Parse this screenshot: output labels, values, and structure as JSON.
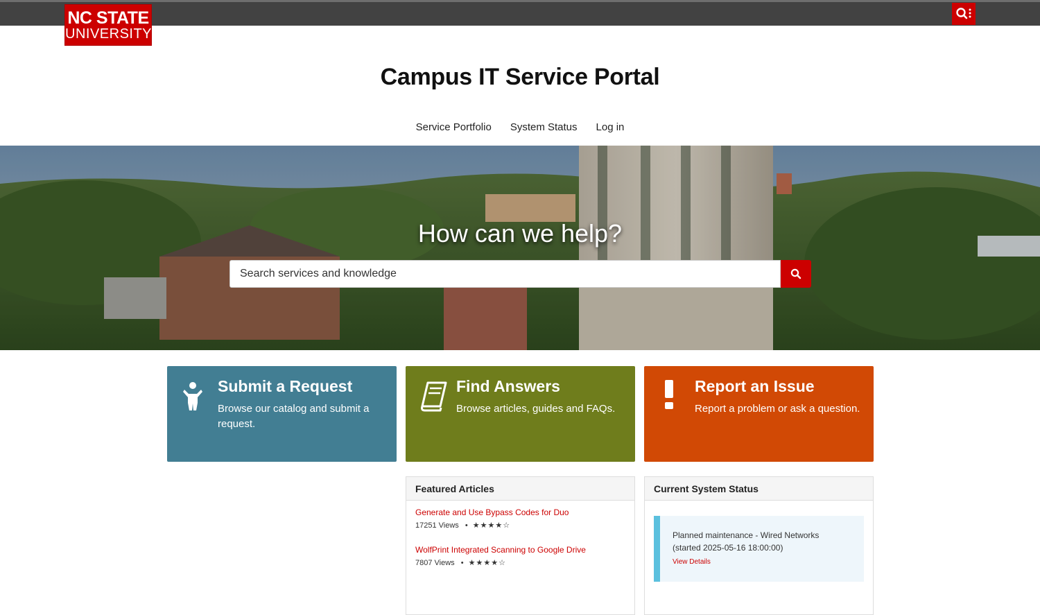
{
  "header": {
    "logo_line1": "NC STATE",
    "logo_line2": "UNIVERSITY",
    "search_toggle_icon": "search-menu-icon"
  },
  "site_title": "Campus IT Service Portal",
  "nav": {
    "items": [
      {
        "label": "Service Portfolio"
      },
      {
        "label": "System Status"
      },
      {
        "label": "Log in"
      }
    ]
  },
  "hero": {
    "heading": "How can we help?",
    "search_placeholder": "Search services and knowledge",
    "search_icon": "search-icon"
  },
  "tiles": [
    {
      "title": "Submit a Request",
      "description": "Browse our catalog and submit a request.",
      "icon": "person-icon",
      "color": "#427e93"
    },
    {
      "title": "Find Answers",
      "description": "Browse articles, guides and FAQs.",
      "icon": "book-icon",
      "color": "#6f7d1c"
    },
    {
      "title": "Report an Issue",
      "description": "Report a problem or ask a question.",
      "icon": "exclamation-icon",
      "color": "#d14905"
    }
  ],
  "featured_articles": {
    "heading": "Featured Articles",
    "items": [
      {
        "title": "Generate and Use Bypass Codes for Duo",
        "views": "17251 Views",
        "separator": "•",
        "stars": "★★★★☆",
        "rating": 4
      },
      {
        "title": "WolfPrint Integrated Scanning to Google Drive",
        "views": "7807 Views",
        "separator": "•",
        "stars": "★★★★☆",
        "rating": 4
      }
    ]
  },
  "system_status": {
    "heading": "Current System Status",
    "items": [
      {
        "text": "Planned maintenance - Wired Networks (started 2025-05-16 18:00:00)",
        "link": "View Details"
      }
    ]
  },
  "colors": {
    "brand_red": "#cc0000",
    "topbar": "#424242",
    "status_accent": "#5bc0de"
  }
}
